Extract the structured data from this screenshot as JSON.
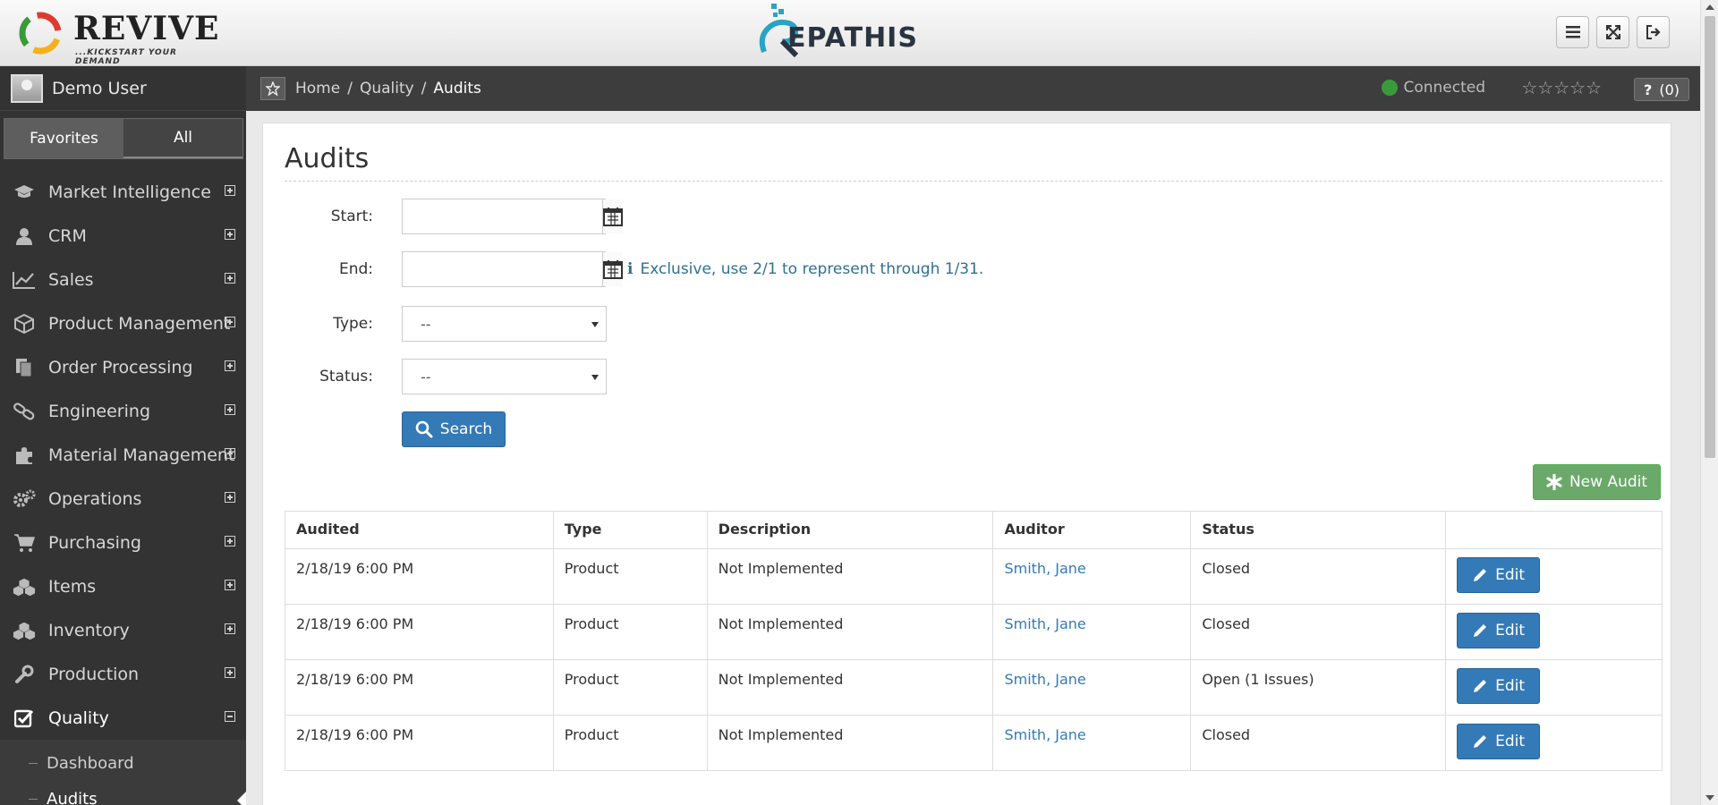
{
  "header": {
    "brand_left": "REVIVE",
    "brand_left_tagline": "...KICKSTART YOUR DEMAND",
    "brand_center": "EPATHIS",
    "buttons": [
      {
        "icon": "menu-icon"
      },
      {
        "icon": "fullscreen-icon"
      },
      {
        "icon": "logout-icon"
      }
    ]
  },
  "sidebar": {
    "user": "Demo User",
    "tabs": [
      "Favorites",
      "All"
    ],
    "items": [
      {
        "label": "Market Intelligence",
        "icon": "graduation-cap-icon"
      },
      {
        "label": "CRM",
        "icon": "user-icon"
      },
      {
        "label": "Sales",
        "icon": "line-chart-icon"
      },
      {
        "label": "Product Management",
        "icon": "cube-icon"
      },
      {
        "label": "Order Processing",
        "icon": "documents-icon"
      },
      {
        "label": "Engineering",
        "icon": "link-icon"
      },
      {
        "label": "Material Management",
        "icon": "puzzle-icon"
      },
      {
        "label": "Operations",
        "icon": "gears-icon"
      },
      {
        "label": "Purchasing",
        "icon": "cart-icon"
      },
      {
        "label": "Items",
        "icon": "cubes-icon"
      },
      {
        "label": "Inventory",
        "icon": "cubes-icon"
      },
      {
        "label": "Production",
        "icon": "wrench-icon"
      },
      {
        "label": "Quality",
        "icon": "check-square-icon"
      }
    ],
    "quality_sub": [
      "Dashboard",
      "Audits"
    ]
  },
  "breadcrumb": {
    "items": [
      "Home",
      "Quality",
      "Audits"
    ],
    "status": "Connected",
    "stars": "☆☆☆☆☆",
    "help_count": "(0)"
  },
  "page": {
    "title": "Audits",
    "form": {
      "start_label": "Start:",
      "end_label": "End:",
      "type_label": "Type:",
      "status_label": "Status:",
      "type_value": "--",
      "status_value": "--",
      "hint": "Exclusive, use 2/1 to represent through 1/31."
    },
    "search_label": "Search",
    "new_label": "New Audit",
    "edit_label": "Edit",
    "table": {
      "headers": [
        "Audited",
        "Type",
        "Description",
        "Auditor",
        "Status"
      ],
      "rows": [
        [
          "2/18/19 6:00 PM",
          "Product",
          "Not Implemented",
          "Smith, Jane",
          "Closed"
        ],
        [
          "2/18/19 6:00 PM",
          "Product",
          "Not Implemented",
          "Smith, Jane",
          "Closed"
        ],
        [
          "2/18/19 6:00 PM",
          "Product",
          "Not Implemented",
          "Smith, Jane",
          "Open (1 Issues)"
        ],
        [
          "2/18/19 6:00 PM",
          "Product",
          "Not Implemented",
          "Smith, Jane",
          "Closed"
        ]
      ]
    }
  },
  "colors": {
    "sidebar_bg": "#333333",
    "primary": "#337ab7",
    "success": "#6aa96a",
    "connected": "#3a9a3a"
  }
}
